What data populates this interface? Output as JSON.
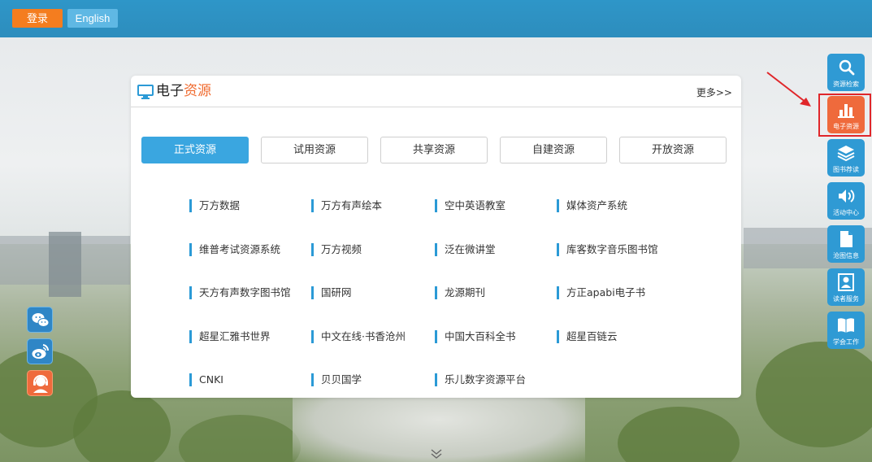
{
  "topbar": {
    "login_label": "登录",
    "english_label": "English"
  },
  "panel": {
    "title_part1": "电子",
    "title_part2": "资源",
    "more_label": "更多>>",
    "tabs": [
      {
        "label": "正式资源",
        "active": true
      },
      {
        "label": "试用资源",
        "active": false
      },
      {
        "label": "共享资源",
        "active": false
      },
      {
        "label": "自建资源",
        "active": false
      },
      {
        "label": "开放资源",
        "active": false
      }
    ],
    "resources": [
      [
        "万方数据",
        "万方有声绘本",
        "空中英语教室",
        "媒体资产系统"
      ],
      [
        "维普考试资源系统",
        "万方视频",
        "泛在微讲堂",
        "库客数字音乐图书馆"
      ],
      [
        "天方有声数字图书馆",
        "国研网",
        "龙源期刊",
        "方正apabi电子书"
      ],
      [
        "超星汇雅书世界",
        "中文在线·书香沧州",
        "中国大百科全书",
        "超星百链云"
      ],
      [
        "CNKI",
        "贝贝国学",
        "乐儿数字资源平台"
      ]
    ]
  },
  "sidebar": {
    "items": [
      {
        "label": "资源检索",
        "icon": "search-icon",
        "active": false
      },
      {
        "label": "电子资源",
        "icon": "bar-chart-icon",
        "active": true
      },
      {
        "label": "图书荐读",
        "icon": "layers-icon",
        "active": false
      },
      {
        "label": "活动中心",
        "icon": "speaker-icon",
        "active": false
      },
      {
        "label": "沧图信息",
        "icon": "document-icon",
        "active": false
      },
      {
        "label": "读者服务",
        "icon": "reader-icon",
        "active": false
      },
      {
        "label": "学会工作",
        "icon": "book-icon",
        "active": false
      }
    ]
  },
  "social": [
    {
      "icon": "wechat-icon"
    },
    {
      "icon": "weibo-icon"
    },
    {
      "icon": "service-icon"
    }
  ],
  "colors": {
    "accent": "#2f9ad4",
    "active": "#ef6a3c",
    "tab_active": "#3aa6e0",
    "title_highlight": "#f06a2e"
  }
}
